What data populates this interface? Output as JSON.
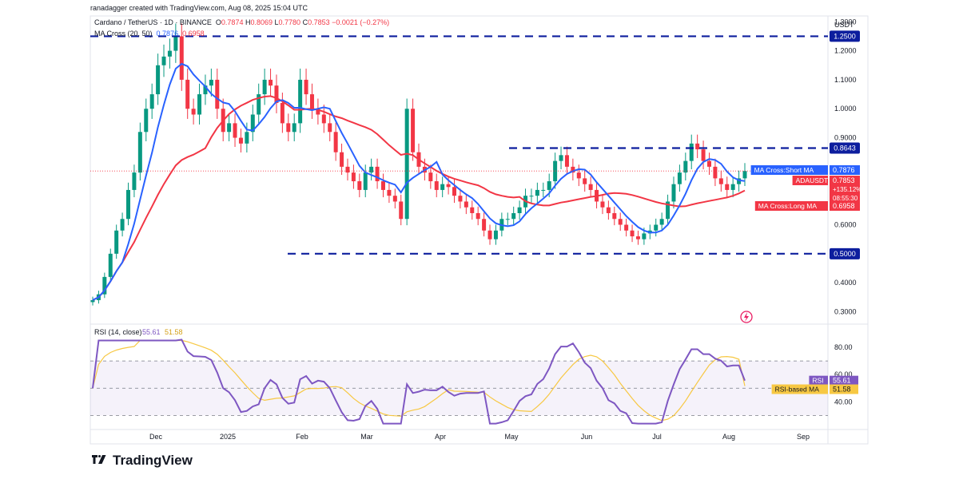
{
  "credit": "ranadagger created with TradingView.com, Aug 08, 2025 15:04 UTC",
  "header": {
    "symbol": "Cardano / TetherUS · 1D · BINANCE",
    "o_label": "O",
    "o": "0.7874",
    "h_label": "H",
    "h": "0.8069",
    "l_label": "L",
    "l": "0.7780",
    "c_label": "C",
    "c": "0.7853",
    "change": "−0.0021 (−0.27%)",
    "ma_label": "MA Cross (20, 50)",
    "ma_short": "0.7876",
    "ma_long": "0.6958"
  },
  "brand": "TradingView",
  "colors": {
    "up": "#089981",
    "down": "#f23645",
    "ma_short": "#2962ff",
    "ma_long": "#f23645",
    "rsi": "#7e57c2",
    "rsi_ma": "#f7c843",
    "level_line": "#0d1e9e"
  },
  "chart_data": {
    "type": "candlestick",
    "price_axis": {
      "unit": "USDT",
      "min": 0.26,
      "max": 1.32,
      "ticks": [
        "1.3000",
        "1.2000",
        "1.1000",
        "1.0000",
        "0.9000",
        "0.6000",
        "0.4000",
        "0.3000"
      ]
    },
    "time_axis": {
      "labels": [
        "Dec",
        "2025",
        "Feb",
        "Mar",
        "Apr",
        "May",
        "Jun",
        "Jul",
        "Aug",
        "Sep"
      ]
    },
    "horizontal_levels": [
      {
        "value": 1.25,
        "label": "1.2500",
        "start": "Nov"
      },
      {
        "value": 0.8643,
        "label": "0.8643",
        "start": "May"
      },
      {
        "value": 0.5,
        "label": "0.5000",
        "start": "Feb"
      }
    ],
    "price_labels": [
      {
        "text": "MA Cross:Short MA",
        "value": "0.7876",
        "color": "#2962ff"
      },
      {
        "text": "ADAUSDT",
        "value": "0.7853",
        "extra": [
          "+135.12%",
          "08:55:30"
        ],
        "color": "#f23645"
      },
      {
        "text": "MA Cross:Long MA",
        "value": "0.6958",
        "color": "#f23645"
      }
    ],
    "candles_close": [
      0.34,
      0.36,
      0.42,
      0.5,
      0.58,
      0.62,
      0.72,
      0.78,
      0.92,
      1.0,
      1.05,
      1.15,
      1.18,
      1.2,
      1.25,
      1.1,
      1.0,
      0.98,
      1.05,
      1.08,
      1.1,
      1.0,
      0.92,
      0.95,
      0.9,
      0.88,
      0.92,
      0.98,
      1.05,
      1.1,
      1.08,
      1.02,
      0.95,
      0.92,
      0.95,
      1.1,
      1.05,
      1.0,
      0.98,
      0.95,
      0.92,
      0.85,
      0.8,
      0.78,
      0.75,
      0.72,
      0.78,
      0.8,
      0.75,
      0.72,
      0.7,
      0.68,
      0.62,
      1.0,
      0.85,
      0.8,
      0.78,
      0.75,
      0.72,
      0.74,
      0.73,
      0.7,
      0.68,
      0.66,
      0.64,
      0.62,
      0.58,
      0.55,
      0.58,
      0.62,
      0.62,
      0.64,
      0.66,
      0.7,
      0.7,
      0.72,
      0.72,
      0.75,
      0.82,
      0.84,
      0.8,
      0.78,
      0.76,
      0.74,
      0.72,
      0.68,
      0.66,
      0.64,
      0.62,
      0.6,
      0.58,
      0.56,
      0.55,
      0.57,
      0.58,
      0.6,
      0.62,
      0.68,
      0.74,
      0.78,
      0.82,
      0.88,
      0.86,
      0.82,
      0.8,
      0.76,
      0.74,
      0.72,
      0.74,
      0.76,
      0.7853
    ],
    "rsi": {
      "label": "RSI (14, close)",
      "value": "55.61",
      "ma_value": "51.58",
      "ticks": [
        "80.00",
        "60.00",
        "40.00"
      ],
      "levels": [
        70,
        50,
        30
      ],
      "labels": [
        {
          "text": "RSI",
          "value": "55.61"
        },
        {
          "text": "RSI-based MA",
          "value": "51.58"
        }
      ]
    }
  }
}
